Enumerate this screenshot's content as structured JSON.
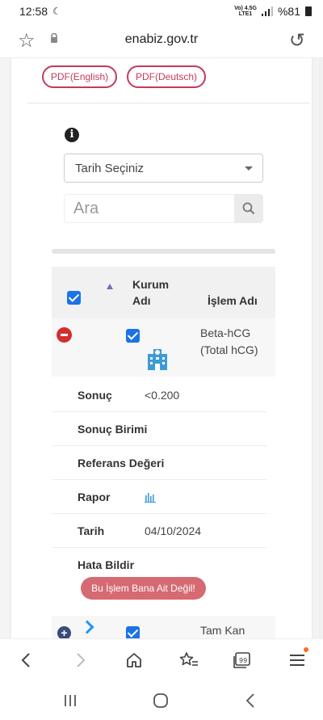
{
  "status_bar": {
    "time": "12:58",
    "network_top": "Vo) 4.5G",
    "network_bottom": "LTE1",
    "battery": "%81"
  },
  "browser": {
    "domain": "enabiz.gov.tr"
  },
  "pdf_buttons": {
    "english": "PDF(English)",
    "deutsch": "PDF(Deutsch)"
  },
  "filter": {
    "date_select": "Tarih Seçiniz",
    "search_placeholder": "Ara"
  },
  "table": {
    "headers": {
      "kurum_line1": "Kurum",
      "kurum_line2": "Adı",
      "islem": "İşlem Adı"
    },
    "row1": {
      "name_line1": "Beta-hCG",
      "name_line2": "(Total hCG)"
    },
    "details": {
      "sonuc_label": "Sonuç",
      "sonuc_value": "<0.200",
      "birim_label": "Sonuç Birimi",
      "referans_label": "Referans Değeri",
      "rapor_label": "Rapor",
      "tarih_label": "Tarih",
      "tarih_value": "04/10/2024",
      "hata_label": "Hata Bildir",
      "hata_button": "Bu İşlem Bana Ait Değil!"
    },
    "row2": {
      "name": "Tam Kan"
    }
  },
  "colors": {
    "accent_pink": "#c43b5b",
    "checkbox_blue": "#1a73e8",
    "minus_red": "#d32f2f",
    "report_button": "#d66a72"
  }
}
